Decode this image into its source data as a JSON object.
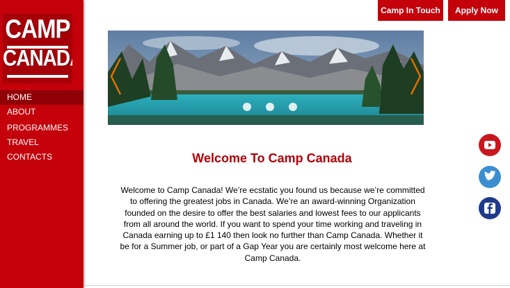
{
  "logo": {
    "line1": "CAMP",
    "line2": "CANADA"
  },
  "nav": {
    "items": [
      {
        "label": "HOME",
        "active": true
      },
      {
        "label": "ABOUT"
      },
      {
        "label": "PROGRAMMES"
      },
      {
        "label": "TRAVEL"
      },
      {
        "label": "CONTACTS"
      }
    ]
  },
  "header": {
    "contact_button": "Camp In Touch",
    "apply_button": "Apply Now"
  },
  "carousel": {
    "slide_count": 3,
    "prev_icon": "chevron-left-icon",
    "next_icon": "chevron-right-icon"
  },
  "main": {
    "title": "Welcome To Camp Canada",
    "paragraph": "Welcome to Camp Canada! We’re ecstatic you found us because we’re committed to offering the greatest jobs in Canada. We’re an award-winning Organization founded on the desire to offer the best salaries and lowest fees to our applicants from all around the world. If you want to spend your time working and traveling in Canada earning up to £1 140 then look no further than Camp Canada. Whether it be for a Summer job, or part of a Gap Year you are certainly most welcome here at Camp Canada."
  },
  "social": [
    {
      "icon": "youtube-icon",
      "color": "#c8171e"
    },
    {
      "icon": "twitter-icon",
      "color": "#3b8fd0"
    },
    {
      "icon": "facebook-icon",
      "color": "#1f3a8c"
    }
  ],
  "colors": {
    "brand_red": "#c4000a",
    "title_red": "#b3000a"
  }
}
